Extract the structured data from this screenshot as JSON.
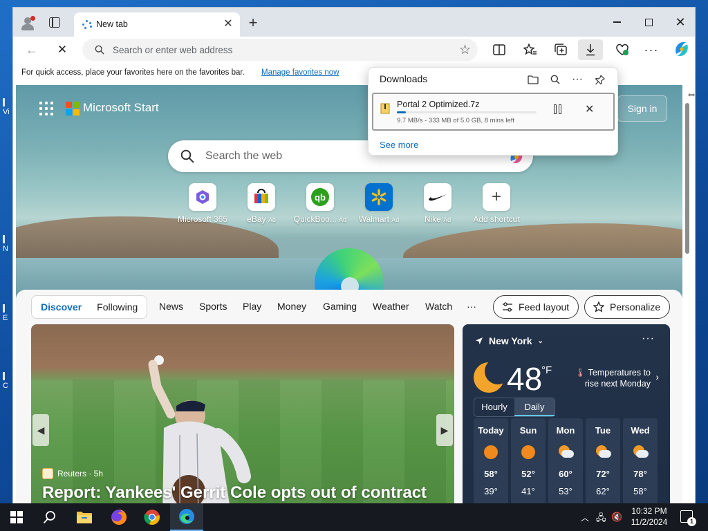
{
  "desktop": {
    "fragments": [
      "Vi",
      "N",
      "E",
      "C"
    ]
  },
  "browser": {
    "tab": {
      "title": "New tab"
    },
    "address": {
      "placeholder": "Search or enter web address"
    },
    "favorites_bar": {
      "text": "For quick access, place your favorites here on the favorites bar.",
      "link": "Manage favorites now"
    },
    "icons": [
      "back-icon",
      "stop-icon",
      "split-screen-icon",
      "favorites-icon",
      "collections-icon",
      "downloads-icon",
      "browser-essentials-icon",
      "more-icon",
      "copilot-icon"
    ]
  },
  "downloads": {
    "title": "Downloads",
    "item": {
      "name": "Portal 2 Optimized.7z",
      "progress": 0.065,
      "status": "9.7 MB/s - 333 MB of 5.0 GB, 8 mins left"
    },
    "see_more": "See more"
  },
  "start_page": {
    "brand": "Microsoft Start",
    "sign_in": "Sign in",
    "search_placeholder": "Search the web",
    "shortcuts": [
      {
        "label": "Microsoft 365",
        "ad": ""
      },
      {
        "label": "eBay",
        "ad": "Ad"
      },
      {
        "label": "QuickBoo...",
        "ad": "Ad"
      },
      {
        "label": "Walmart",
        "ad": "Ad"
      },
      {
        "label": "Nike",
        "ad": "Ad"
      },
      {
        "label": "Add shortcut",
        "ad": ""
      }
    ],
    "feed_tabs": [
      "Discover",
      "Following"
    ],
    "nav": [
      "News",
      "Sports",
      "Play",
      "Money",
      "Gaming",
      "Weather",
      "Watch",
      "···"
    ],
    "feed_layout": "Feed layout",
    "personalize": "Personalize",
    "news": {
      "source": "Reuters · 5h",
      "headline": "Report: Yankees' Gerrit Cole opts out of contract"
    },
    "weather": {
      "location": "New York",
      "temp": "48",
      "unit": "°F",
      "alert": "Temperatures to rise next Monday",
      "tabs": [
        "Hourly",
        "Daily"
      ],
      "days": [
        {
          "name": "Today",
          "hi": "58°",
          "lo": "39°",
          "icon": "sunny"
        },
        {
          "name": "Sun",
          "hi": "52°",
          "lo": "41°",
          "icon": "sunny"
        },
        {
          "name": "Mon",
          "hi": "60°",
          "lo": "53°",
          "icon": "partly-cloudy"
        },
        {
          "name": "Tue",
          "hi": "72°",
          "lo": "62°",
          "icon": "partly-cloudy"
        },
        {
          "name": "Wed",
          "hi": "78°",
          "lo": "58°",
          "icon": "partly-cloudy"
        }
      ]
    }
  },
  "taskbar": {
    "time": "10:32 PM",
    "date": "11/2/2024",
    "notifications": "1"
  },
  "colors": {
    "accent": "#0f6cbd",
    "taskbar": "#16191f",
    "weather_bg": "#1e2d44"
  }
}
